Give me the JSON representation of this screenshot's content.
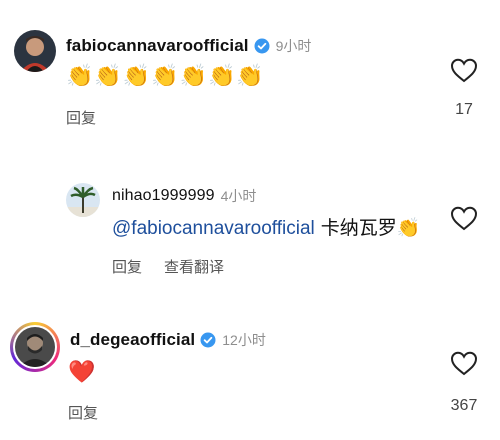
{
  "comments": [
    {
      "username": "fabiocannavaroofficial",
      "time": "9小时",
      "text": "👏👏👏👏👏👏👏",
      "reply_label": "回复",
      "likes": "17"
    },
    {
      "username": "nihao1999999",
      "time": "4小时",
      "mention": "@fabiocannavaroofficial",
      "text": " 卡纳瓦罗👏",
      "reply_label": "回复",
      "translate_label": "查看翻译"
    },
    {
      "username": "d_degeaofficial",
      "time": "12小时",
      "text": "❤️",
      "reply_label": "回复",
      "likes": "367"
    }
  ],
  "colors": {
    "verified": "#3897f0",
    "mention": "#1e4f9c",
    "muted": "#8e8e8e"
  },
  "icons": [
    "verified-badge-icon",
    "heart-outline-icon"
  ]
}
